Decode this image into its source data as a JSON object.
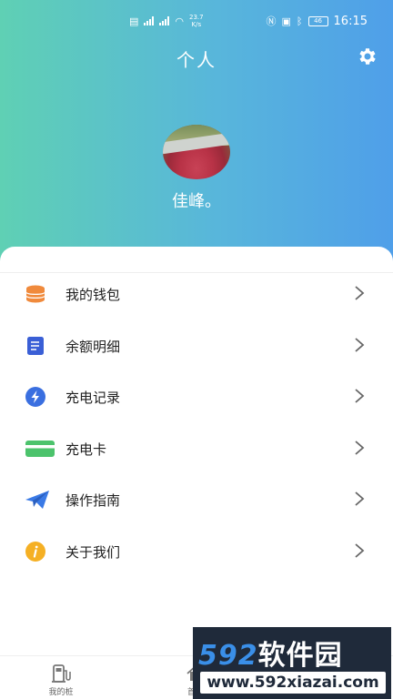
{
  "status_bar": {
    "net_speed_value": "23.7",
    "net_speed_unit": "K/s",
    "battery": "46",
    "time": "16:15"
  },
  "header": {
    "title": "个人",
    "nickname": "佳峰。"
  },
  "menu": [
    {
      "label": "我的钱包",
      "icon": "wallet-icon",
      "color": "#f08a3c"
    },
    {
      "label": "余额明细",
      "icon": "balance-detail-icon",
      "color": "#3a5fd6"
    },
    {
      "label": "充电记录",
      "icon": "charge-record-icon",
      "color": "#3a6fe0"
    },
    {
      "label": "充电卡",
      "icon": "charge-card-icon",
      "color": "#4cc36c"
    },
    {
      "label": "操作指南",
      "icon": "guide-icon",
      "color": "#3a7ae6"
    },
    {
      "label": "关于我们",
      "icon": "about-icon",
      "color": "#f5b024"
    }
  ],
  "tabbar": {
    "my_pile": "我的桩",
    "home": "首页"
  },
  "watermark": {
    "digits": "592",
    "brand": "软件园",
    "url": "www.592xiazai.com"
  },
  "colors": {
    "header_gradient_start": "#5fd0b4",
    "header_gradient_end": "#4f9fe9"
  }
}
